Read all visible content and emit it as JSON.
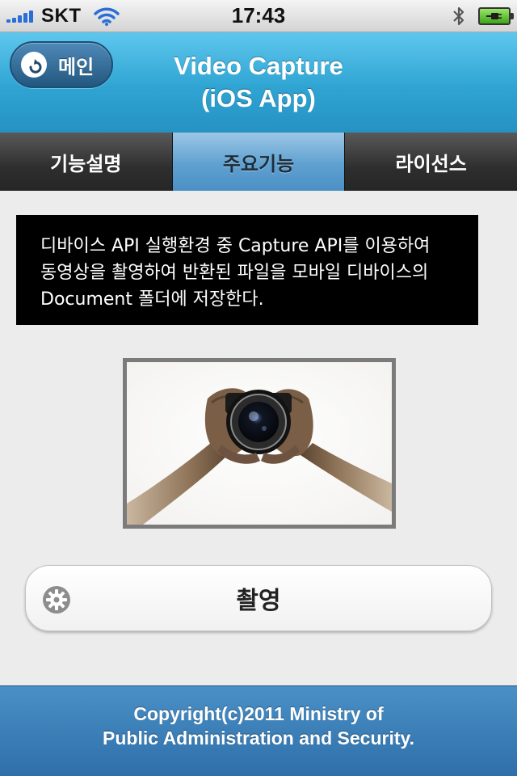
{
  "status_bar": {
    "carrier": "SKT",
    "time": "17:43",
    "signal_bars": 5
  },
  "header": {
    "back_label": "메인",
    "title_line1": "Video Capture",
    "title_line2": "(iOS App)"
  },
  "tabs": [
    {
      "label": "기능설명",
      "active": false
    },
    {
      "label": "주요기능",
      "active": true
    },
    {
      "label": "라이선스",
      "active": false
    }
  ],
  "description": "디바이스 API 실행환경 중 Capture API를 이용하여\n동영상을 촬영하여 반환된 파일을 모바일 디바이스의\nDocument 폴더에 저장한다.",
  "capture_button": {
    "label": "촬영",
    "icon": "gear-icon"
  },
  "footer": {
    "line1": "Copyright(c)2011 Ministry of",
    "line2": "Public Administration and Security."
  },
  "colors": {
    "header_blue": "#2fa4d3",
    "footer_blue": "#3f82bd",
    "active_tab": "#5fa0d0"
  }
}
